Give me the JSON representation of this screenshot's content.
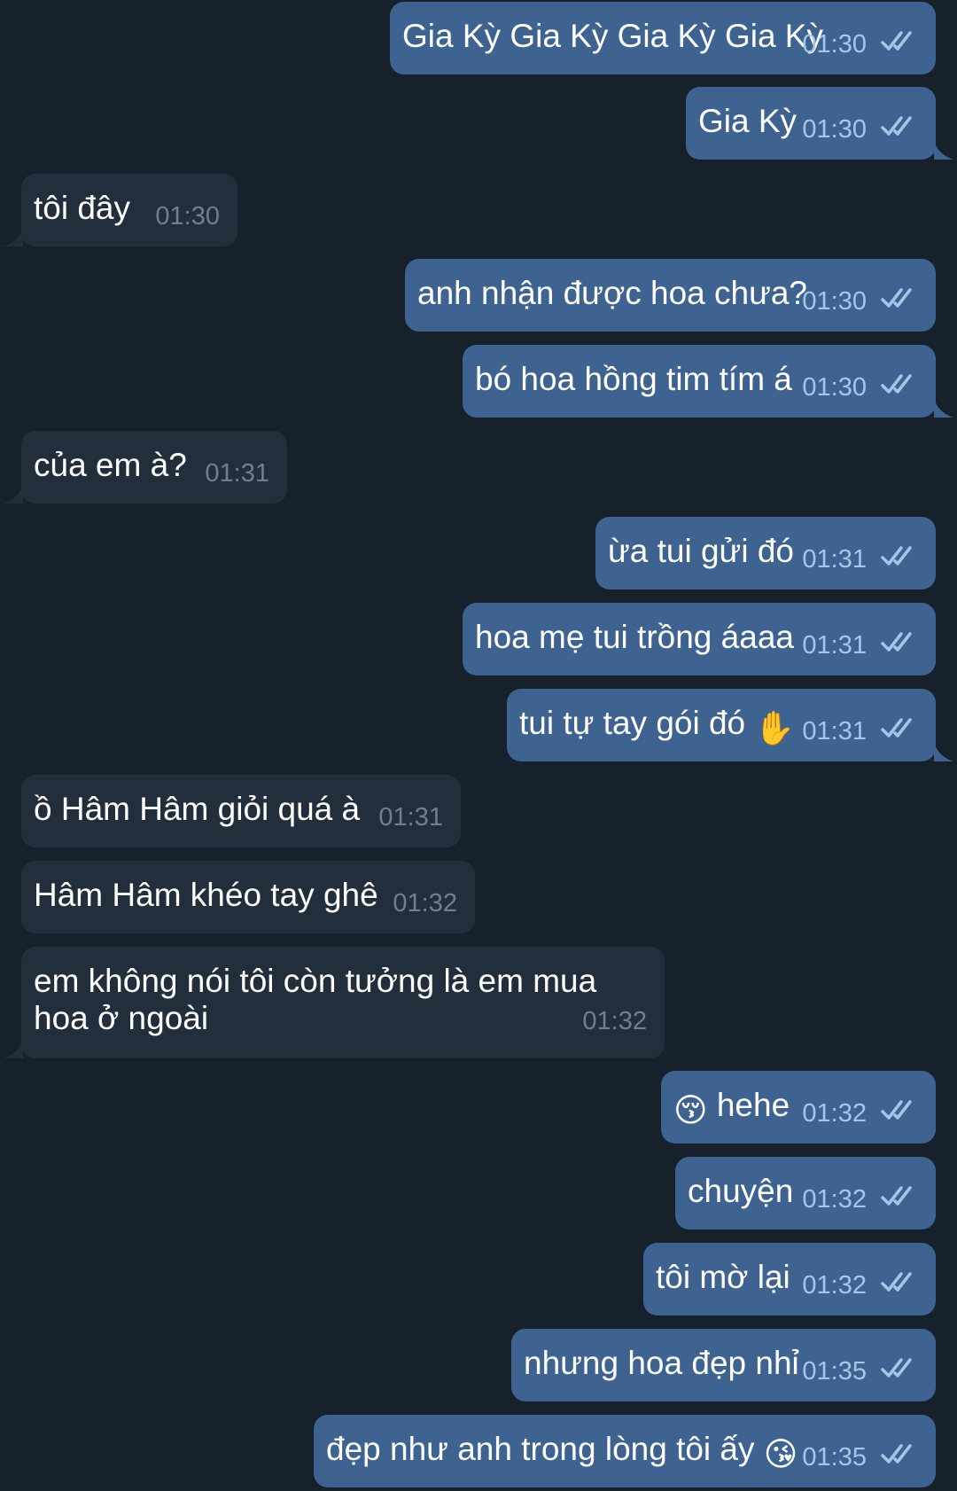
{
  "colors": {
    "background": "#17212b",
    "outgoing_bubble": "#3e6391",
    "incoming_bubble": "#232e3c",
    "outgoing_time": "#a5c6e8",
    "incoming_time": "#6e7f90",
    "read_ticks": "#a5c6e8"
  },
  "messages": [
    {
      "text": "Gia Kỳ Gia Kỳ Gia Kỳ Gia Kỳ",
      "time": "01:30",
      "direction": "out",
      "status": "read"
    },
    {
      "text": "Gia Kỳ",
      "time": "01:30",
      "direction": "out",
      "status": "read"
    },
    {
      "text": "tôi đây",
      "time": "01:30",
      "direction": "in"
    },
    {
      "text": "anh nhận được hoa chưa?",
      "time": "01:30",
      "direction": "out",
      "status": "read"
    },
    {
      "text": "bó hoa hồng tim tím á",
      "time": "01:30",
      "direction": "out",
      "status": "read"
    },
    {
      "text": "của em à?",
      "time": "01:31",
      "direction": "in"
    },
    {
      "text": "ừa tui gửi đó",
      "time": "01:31",
      "direction": "out",
      "status": "read"
    },
    {
      "text": "hoa mẹ tui trồng áaaa",
      "time": "01:31",
      "direction": "out",
      "status": "read"
    },
    {
      "text": "tui tự tay gói đó",
      "emoji": "✋",
      "time": "01:31",
      "direction": "out",
      "status": "read"
    },
    {
      "text": "ồ Hâm Hâm giỏi quá à",
      "time": "01:31",
      "direction": "in"
    },
    {
      "text": "Hâm Hâm khéo tay ghê",
      "time": "01:32",
      "direction": "in"
    },
    {
      "text": "em không nói tôi còn tưởng là em mua hoa ở ngoài",
      "time": "01:32",
      "direction": "in"
    },
    {
      "emoji": "😚",
      "text": "hehe",
      "time": "01:32",
      "direction": "out",
      "status": "read"
    },
    {
      "text": "chuyện",
      "time": "01:32",
      "direction": "out",
      "status": "read"
    },
    {
      "text": "tôi mờ lại",
      "time": "01:32",
      "direction": "out",
      "status": "read"
    },
    {
      "text": "nhưng hoa đẹp nhỉ",
      "time": "01:35",
      "direction": "out",
      "status": "read"
    },
    {
      "text": "đẹp như anh trong lòng tôi ấy",
      "emoji": "😘",
      "time": "01:35",
      "direction": "out",
      "status": "read"
    }
  ]
}
